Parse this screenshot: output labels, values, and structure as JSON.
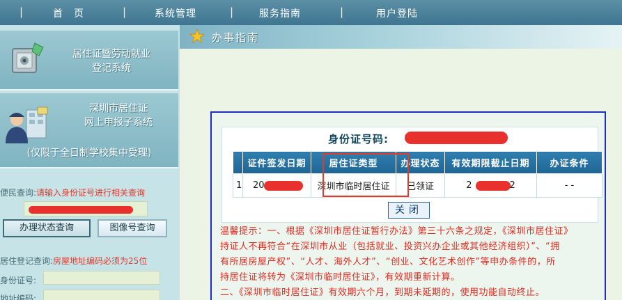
{
  "topnav": {
    "items": [
      "首　页",
      "系统管理",
      "服务指南",
      "用户登陆"
    ]
  },
  "sidebar": {
    "panel1_title_line1": "居住证暨劳动就业",
    "panel1_title_line2": "登记系统",
    "panel2_title_line1": "深圳市居住证",
    "panel2_title_line2": "网上申报子系统",
    "panel2_subtitle": "(仅限于全日制学校集中受理)",
    "quick_query_label": "便民查询:",
    "quick_query_hint": "请输入身份证号进行相关查询",
    "btn_status": "办理状态查询",
    "btn_photo": "图像号查询",
    "residence_label": "居住登记查询:",
    "residence_hint": "房屋地址编码必须为25位",
    "id_label": "身份证号:",
    "addr_label": "地址编码:"
  },
  "main": {
    "title": "办事指南"
  },
  "dialog": {
    "id_label": "身份证号码:",
    "headers": [
      "",
      "证件签发日期",
      "居住证类型",
      "办理状态",
      "有效期限截止日期",
      "办证条件"
    ],
    "row": {
      "index": "1",
      "issue_date_prefix": "20",
      "type": "深圳市临时居住证",
      "status": "已领证",
      "expiry_prefix": "2",
      "expiry_suffix": "2",
      "conditions": "- -"
    },
    "close_label": "关闭",
    "notice_line1": "温馨提示：一、根据《深圳市居住证暂行办法》第三十六条之规定，《深圳市居住证》",
    "notice_line2": "持证人不再符合“在深圳市从业（包括就业、投资兴办企业或其他经济组织）”、“拥",
    "notice_line3": "有所居房屋产权”、“人才、海外人才”、“创业、文化艺术创作”等申办条件的，所",
    "notice_line4": "持居住证将转为《深圳市临时居住证》，有效期重新计算。",
    "notice_line5": "二、《深圳市临时居住证》有效期六个月，到期未延期的，使用功能自动终止。"
  },
  "colors": {
    "nav_bg": "#4a8098",
    "header_blue": "#1e6595",
    "notice_red": "#e22b1f",
    "highlight_red": "#e23b2a"
  }
}
